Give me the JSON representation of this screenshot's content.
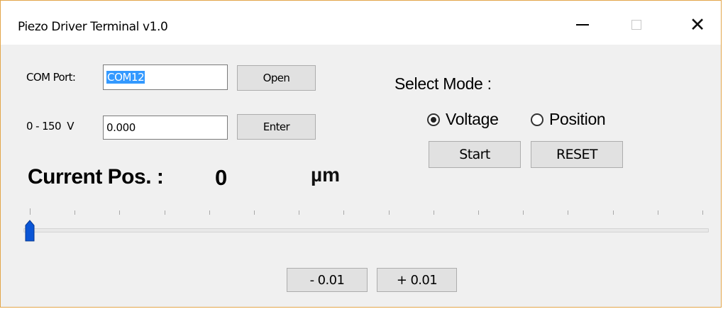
{
  "window": {
    "title": "Piezo Driver Terminal v1.0",
    "minimize_glyph": "—",
    "maximize_glyph": "☐",
    "close_glyph": "✕"
  },
  "com_port": {
    "label": "COM Port:",
    "value": "COM12",
    "open_label": "Open"
  },
  "voltage": {
    "label": "0 - 150  V",
    "value": "0.000",
    "enter_label": "Enter"
  },
  "mode": {
    "label": "Select Mode :",
    "options": [
      {
        "label": "Voltage",
        "selected": true
      },
      {
        "label": "Position",
        "selected": false
      }
    ],
    "start_label": "Start",
    "reset_label": "RESET"
  },
  "position": {
    "label": "Current Pos. :",
    "value": "0",
    "unit": "µm"
  },
  "slider": {
    "value": 0,
    "min": 0,
    "max": 100,
    "tick_count": 16,
    "thumb_color": "#0a55d6"
  },
  "step": {
    "minus_label": "- 0.01",
    "plus_label": "+ 0.01"
  },
  "colors": {
    "border_accent": "#e3a64a",
    "selection": "#3399ff"
  }
}
